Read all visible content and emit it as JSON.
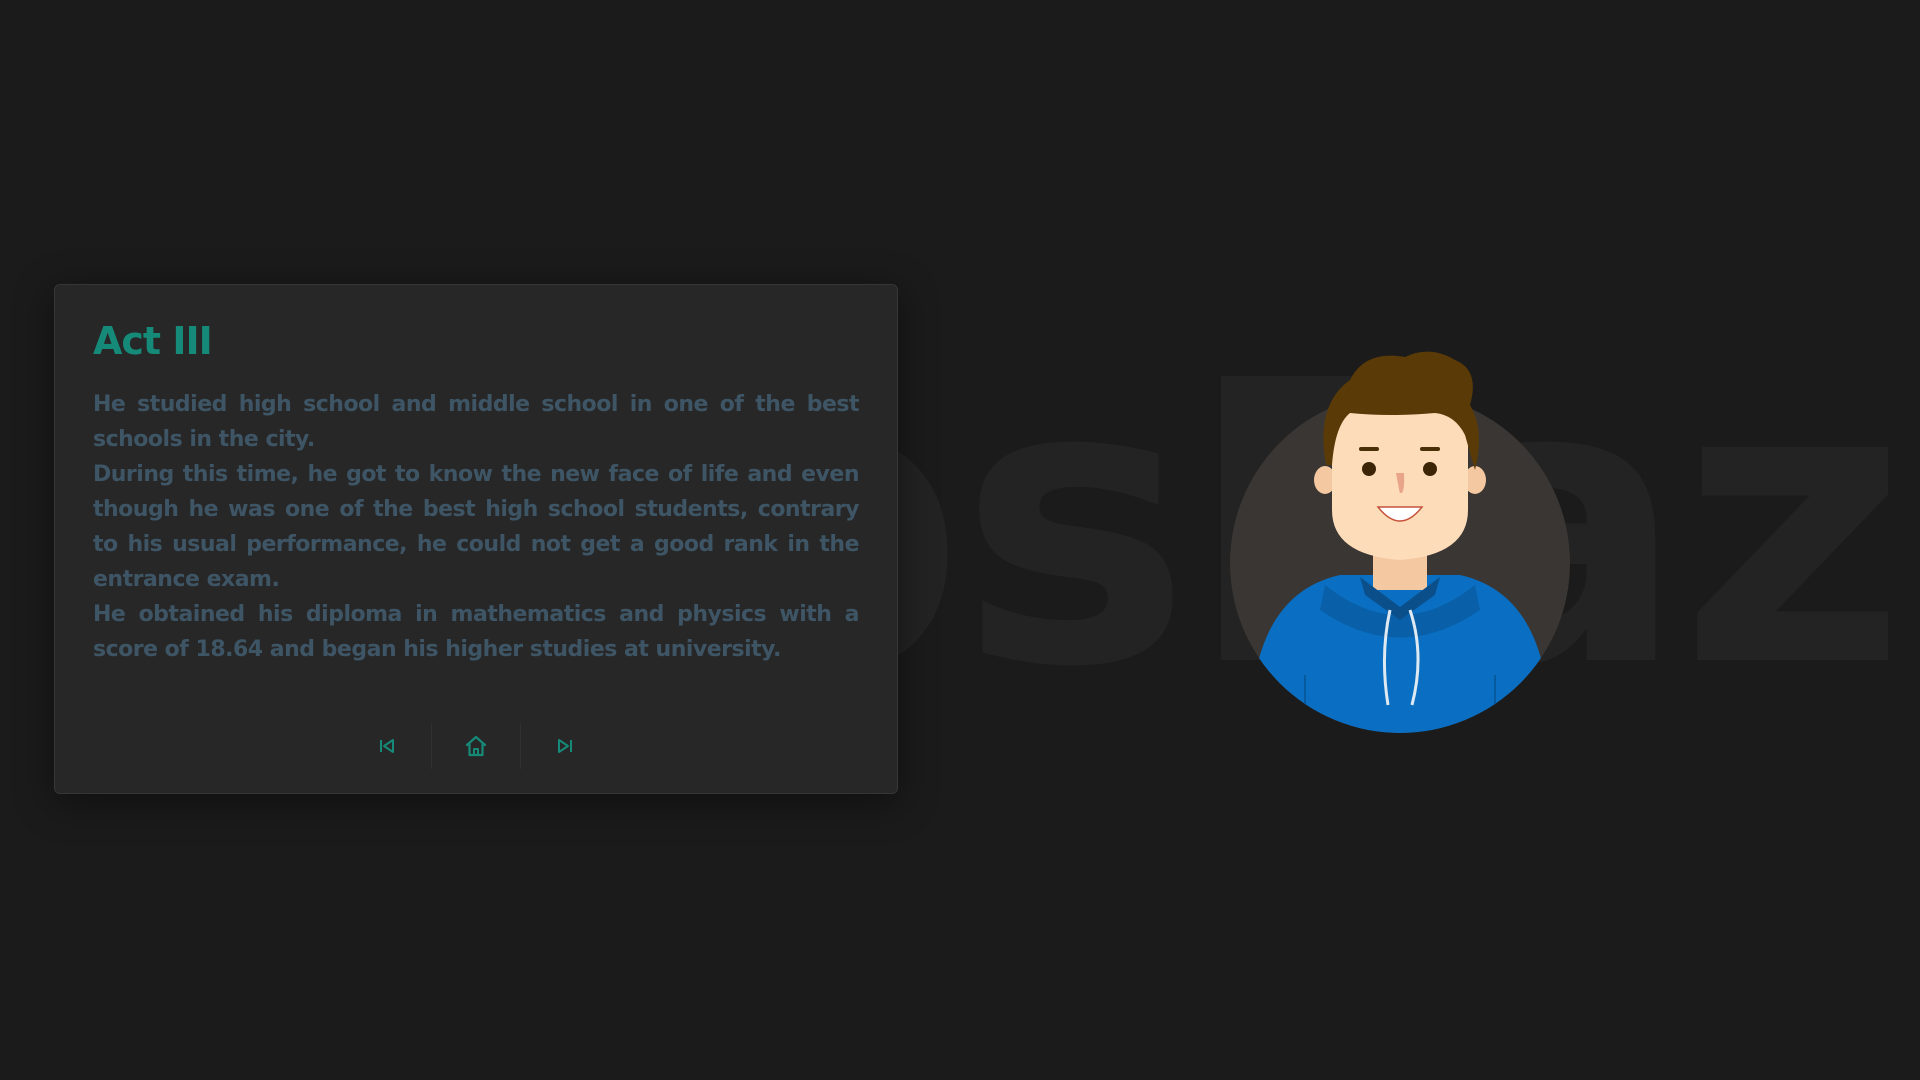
{
  "background": {
    "watermark_text": "ÅbsFazli"
  },
  "card": {
    "title": "Act III",
    "paragraphs": [
      "He studied high school and middle school in one of the best schools in the city.",
      "During this time, he got to know the new face of life and even though he was one of the best high school students, contrary to his usual performance, he could not get a good rank in the entrance exam.",
      "He obtained his diploma in mathematics and physics with a score of 18.64 and began his higher studies at university."
    ],
    "nav": {
      "previous_icon": "skip-previous-icon",
      "home_icon": "home-icon",
      "next_icon": "skip-next-icon"
    }
  },
  "avatar": {
    "icon": "boy-avatar-illustration"
  },
  "colors": {
    "background": "#1b1b1b",
    "accent": "#168a78",
    "body_text": "#3e5566",
    "hoodie": "#0a6fc2",
    "hair": "#5a3b08",
    "skin": "#fddcb9"
  }
}
